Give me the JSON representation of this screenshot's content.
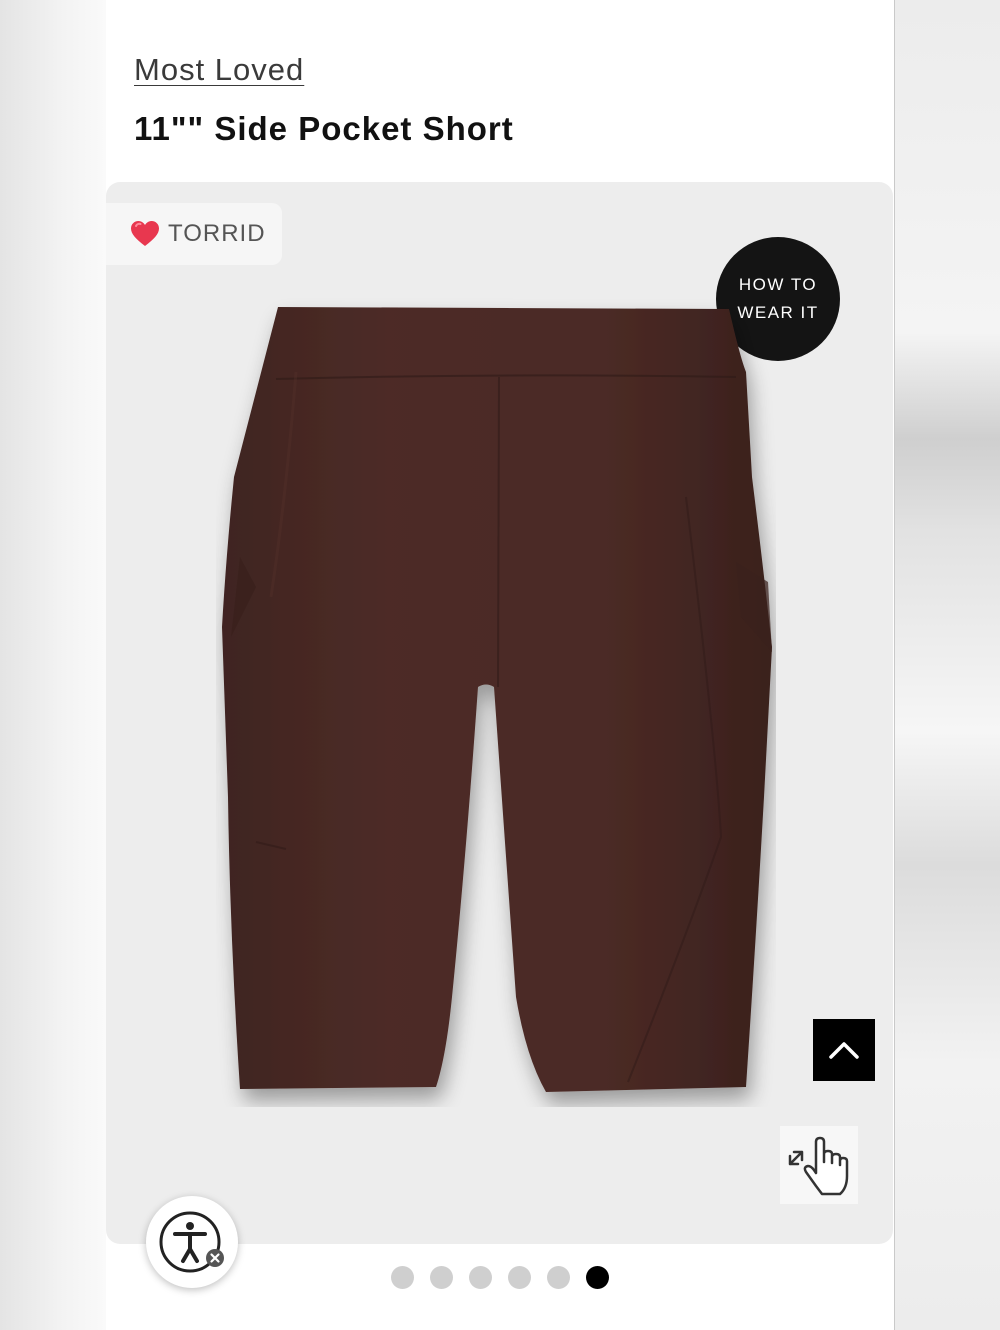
{
  "header": {
    "eyebrow": "Most Loved",
    "product_title": "11\"\" Side Pocket Short"
  },
  "card": {
    "brand_label": "TORRID",
    "how_to_line1": "HOW TO",
    "how_to_line2": "WEAR IT"
  },
  "icons": {
    "brand": "heart-icon",
    "scroll_top": "chevron-up-icon",
    "zoom": "tap-zoom-icon",
    "accessibility": "accessibility-icon"
  },
  "colors": {
    "product": "#4a2a26",
    "heart": "#e8374f",
    "active_dot": "#000000",
    "inactive_dot": "#cfcfcf"
  },
  "carousel": {
    "total": 6,
    "active_index": 5
  }
}
